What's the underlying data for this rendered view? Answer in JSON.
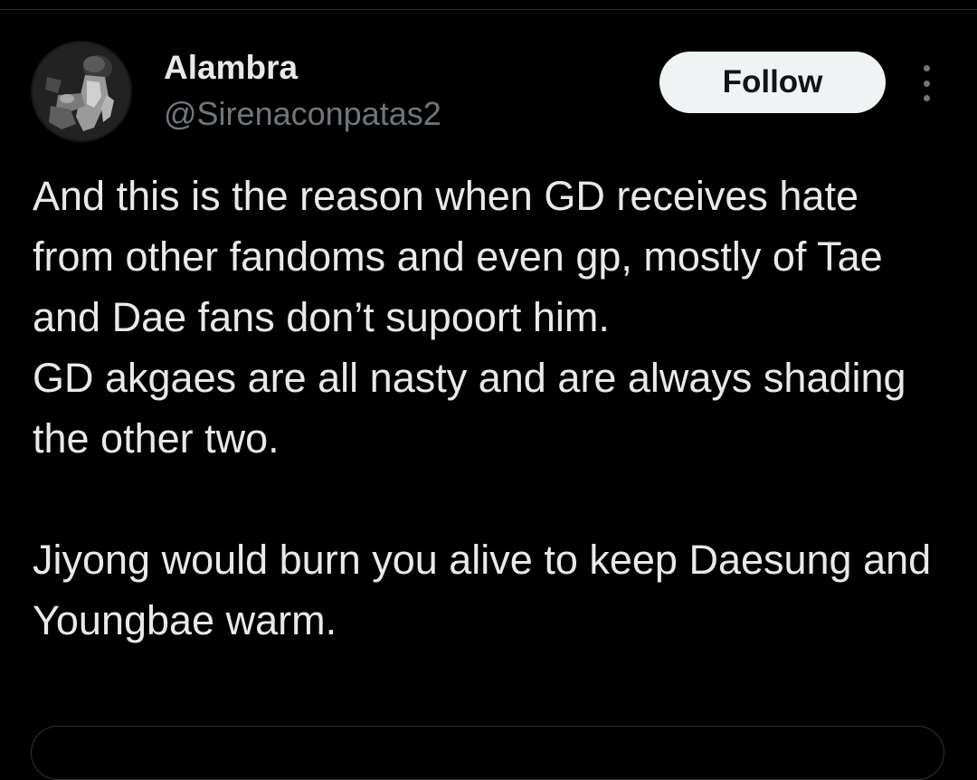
{
  "tweet": {
    "author": {
      "name": "Alambra",
      "handle": "@Sirenaconpatas2",
      "avatar_icon": "user-avatar-photo"
    },
    "follow_label": "Follow",
    "more_icon": "more-options-vertical-dots-icon",
    "text": {
      "paragraph_1": "And this is the reason when GD receives hate from other fandoms and even gp, mostly of Tae and Dae fans don’t supoort him.\nGD akgaes are all nasty and are always shading the other two.",
      "paragraph_2": "Jiyong would burn you alive to keep Daesung and Youngbae warm."
    }
  },
  "colors": {
    "background": "#000000",
    "primary_text": "#e7e9ea",
    "secondary_text": "#71767b",
    "follow_button_bg": "#eff3f4",
    "follow_button_text": "#0f1419",
    "border": "#2f3336"
  }
}
